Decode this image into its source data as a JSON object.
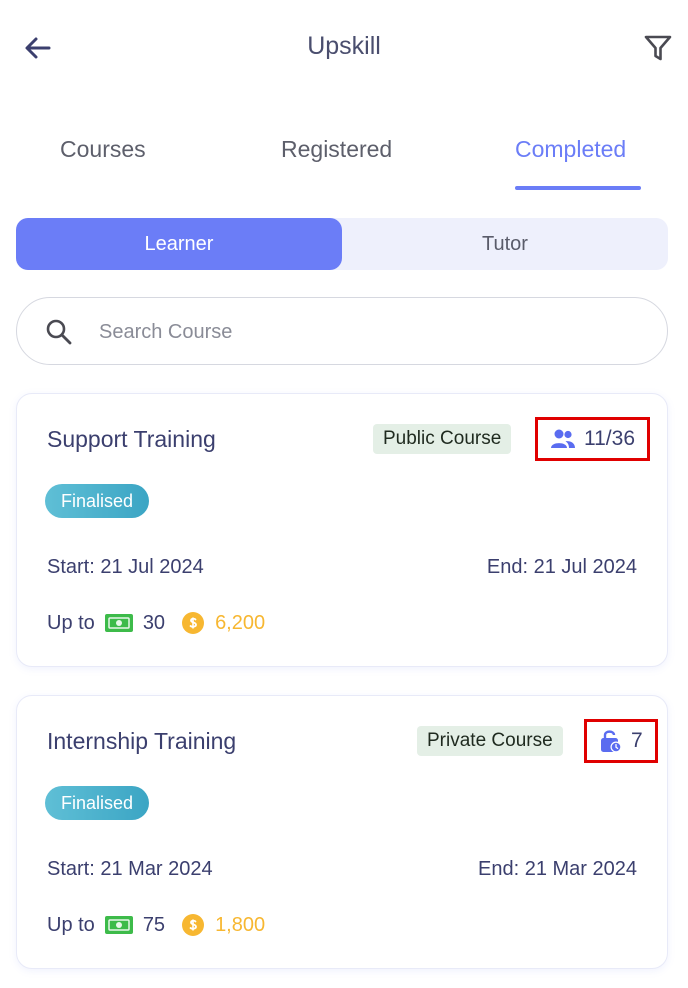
{
  "header": {
    "title": "Upskill",
    "back_icon": "arrow-left-icon",
    "filter_icon": "filter-icon"
  },
  "tabs": [
    {
      "label": "Courses",
      "active": false
    },
    {
      "label": "Registered",
      "active": false
    },
    {
      "label": "Completed",
      "active": true
    }
  ],
  "segment": {
    "learner": "Learner",
    "tutor": "Tutor",
    "selected": "Learner"
  },
  "search": {
    "placeholder": "Search Course",
    "value": ""
  },
  "courses": [
    {
      "title": "Support Training",
      "type": "Public Course",
      "count_icon": "users-icon",
      "count": "11/36",
      "status": "Finalised",
      "start": "Start: 21 Jul 2024",
      "end": "End: 21 Jul 2024",
      "upto": "Up to",
      "cash": "30",
      "coins": "6,200"
    },
    {
      "title": "Internship Training",
      "type": "Private Course",
      "count_icon": "lock-icon",
      "count": "7",
      "status": "Finalised",
      "start": "Start: 21 Mar 2024",
      "end": "End: 21 Mar 2024",
      "upto": "Up to",
      "cash": "75",
      "coins": "1,800"
    }
  ],
  "colors": {
    "accent": "#6b7df7",
    "coin": "#f7b731",
    "cash": "#3dbb4a",
    "highlight": "#e00000"
  }
}
